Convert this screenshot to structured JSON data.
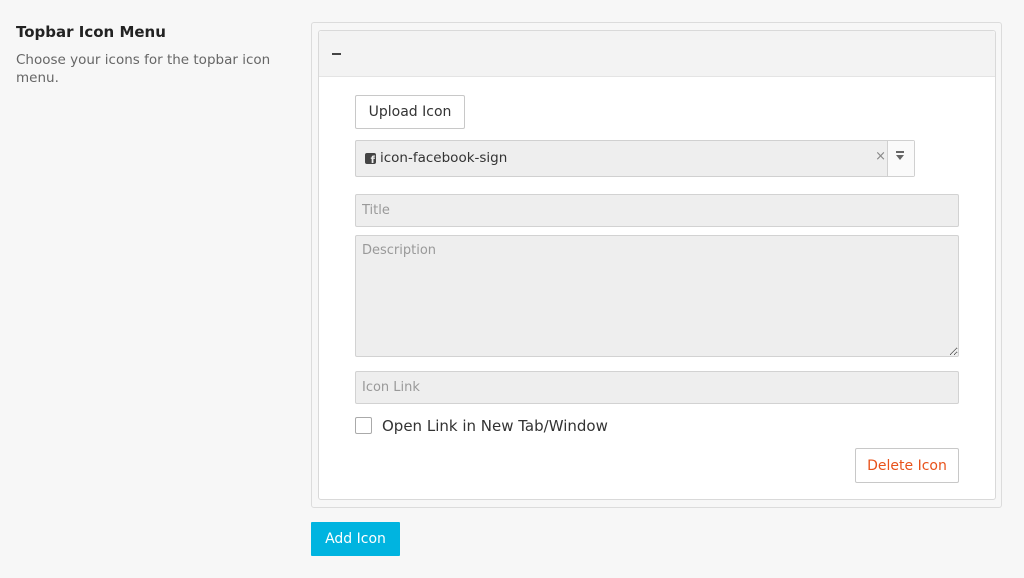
{
  "section": {
    "title": "Topbar Icon Menu",
    "description": "Choose your icons for the topbar icon menu."
  },
  "panel": {
    "collapse_icon": "minus-icon",
    "upload_label": "Upload Icon",
    "icon_select": {
      "value": "icon-facebook-sign",
      "icon": "facebook-sign-icon",
      "clear_symbol": "×",
      "arrow_icon": "chevron-down-icon"
    },
    "title_placeholder": "Title",
    "description_placeholder": "Description",
    "link_placeholder": "Icon Link",
    "new_tab_label": "Open Link in New Tab/Window",
    "new_tab_checked": false,
    "delete_label": "Delete Icon"
  },
  "add_label": "Add Icon",
  "colors": {
    "accent": "#00b4e0",
    "delete_text": "#e8521b",
    "input_bg": "#eeeeee"
  }
}
